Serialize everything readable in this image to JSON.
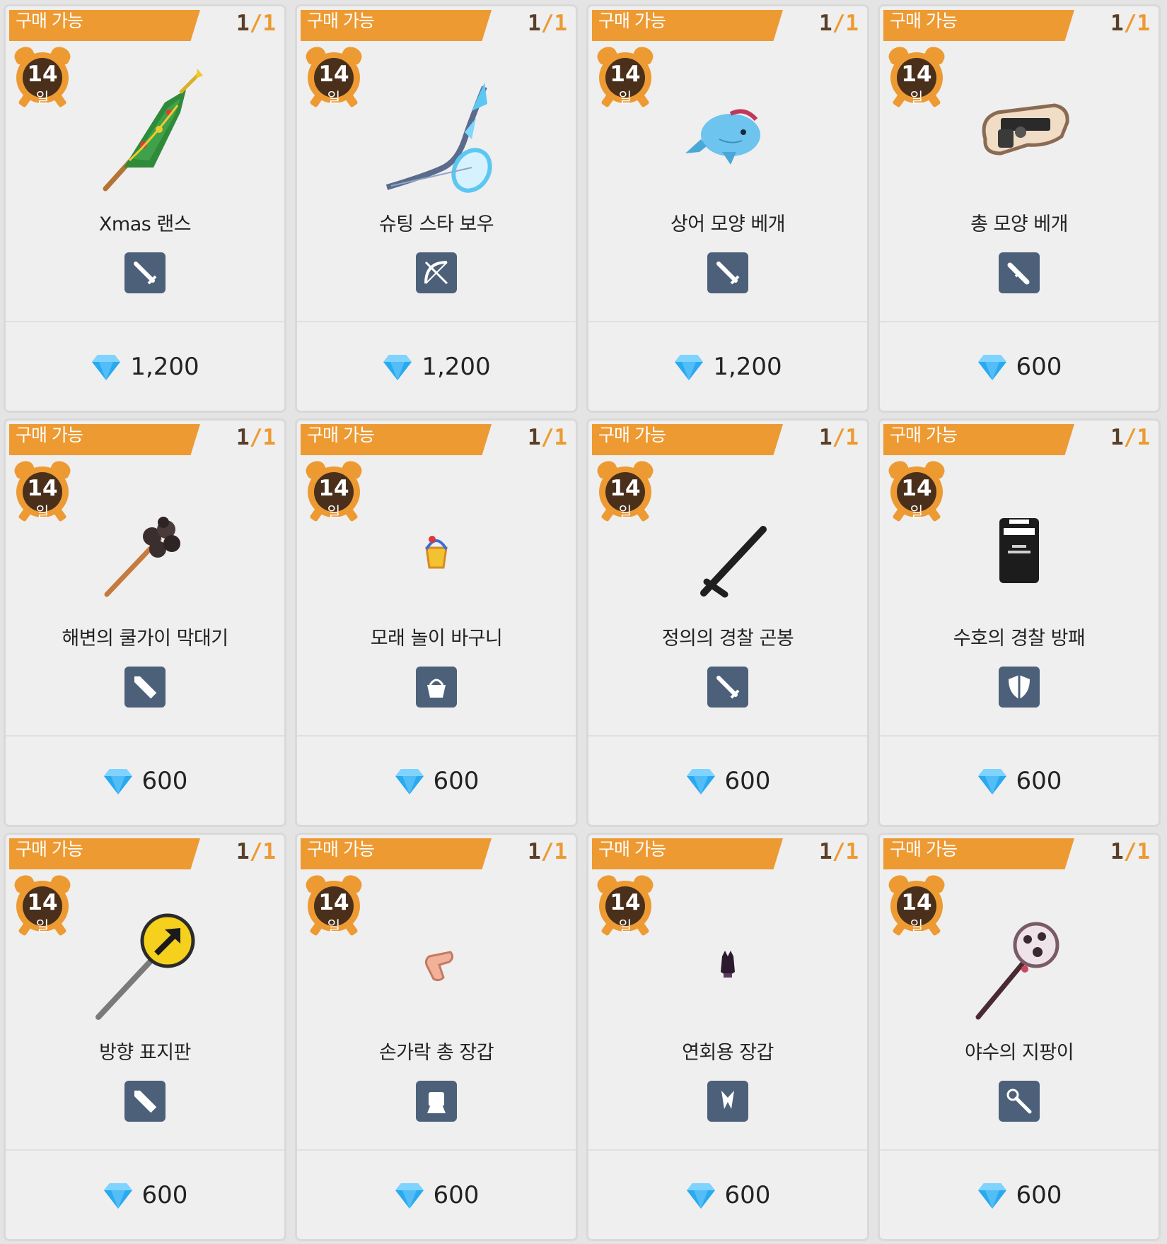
{
  "shop": {
    "items": [
      {
        "status": "구매 가능",
        "stock_current": "1",
        "stock_sep": "/",
        "stock_max": "1",
        "timer_value": "14",
        "timer_unit": "일",
        "name": "Xmas 랜스",
        "price": "1,200",
        "art_icon": "xmas-lance-icon",
        "type_icon": "sword-type-icon"
      },
      {
        "status": "구매 가능",
        "stock_current": "1",
        "stock_sep": "/",
        "stock_max": "1",
        "timer_value": "14",
        "timer_unit": "일",
        "name": "슈팅 스타 보우",
        "price": "1,200",
        "art_icon": "shooting-star-bow-icon",
        "type_icon": "bow-type-icon"
      },
      {
        "status": "구매 가능",
        "stock_current": "1",
        "stock_sep": "/",
        "stock_max": "1",
        "timer_value": "14",
        "timer_unit": "일",
        "name": "상어 모양 베개",
        "price": "1,200",
        "art_icon": "shark-pillow-icon",
        "type_icon": "sword-type-icon"
      },
      {
        "status": "구매 가능",
        "stock_current": "1",
        "stock_sep": "/",
        "stock_max": "1",
        "timer_value": "14",
        "timer_unit": "일",
        "name": "총 모양 베개",
        "price": "600",
        "art_icon": "gun-pillow-icon",
        "type_icon": "gun-type-icon"
      },
      {
        "status": "구매 가능",
        "stock_current": "1",
        "stock_sep": "/",
        "stock_max": "1",
        "timer_value": "14",
        "timer_unit": "일",
        "name": "해변의 쿨가이 막대기",
        "price": "600",
        "art_icon": "beach-stick-icon",
        "type_icon": "blade-type-icon"
      },
      {
        "status": "구매 가능",
        "stock_current": "1",
        "stock_sep": "/",
        "stock_max": "1",
        "timer_value": "14",
        "timer_unit": "일",
        "name": "모래 놀이 바구니",
        "price": "600",
        "art_icon": "sand-basket-icon",
        "type_icon": "basket-type-icon"
      },
      {
        "status": "구매 가능",
        "stock_current": "1",
        "stock_sep": "/",
        "stock_max": "1",
        "timer_value": "14",
        "timer_unit": "일",
        "name": "정의의 경찰 곤봉",
        "price": "600",
        "art_icon": "police-baton-icon",
        "type_icon": "sword-type-icon"
      },
      {
        "status": "구매 가능",
        "stock_current": "1",
        "stock_sep": "/",
        "stock_max": "1",
        "timer_value": "14",
        "timer_unit": "일",
        "name": "수호의 경찰 방패",
        "price": "600",
        "art_icon": "police-shield-icon",
        "type_icon": "shield-type-icon"
      },
      {
        "status": "구매 가능",
        "stock_current": "1",
        "stock_sep": "/",
        "stock_max": "1",
        "timer_value": "14",
        "timer_unit": "일",
        "name": "방향 표지판",
        "price": "600",
        "art_icon": "direction-sign-icon",
        "type_icon": "blade-type-icon"
      },
      {
        "status": "구매 가능",
        "stock_current": "1",
        "stock_sep": "/",
        "stock_max": "1",
        "timer_value": "14",
        "timer_unit": "일",
        "name": "손가락 총 장갑",
        "price": "600",
        "art_icon": "finger-gun-glove-icon",
        "type_icon": "fist-type-icon"
      },
      {
        "status": "구매 가능",
        "stock_current": "1",
        "stock_sep": "/",
        "stock_max": "1",
        "timer_value": "14",
        "timer_unit": "일",
        "name": "연회용 장갑",
        "price": "600",
        "art_icon": "banquet-glove-icon",
        "type_icon": "claw-type-icon"
      },
      {
        "status": "구매 가능",
        "stock_current": "1",
        "stock_sep": "/",
        "stock_max": "1",
        "timer_value": "14",
        "timer_unit": "일",
        "name": "야수의 지팡이",
        "price": "600",
        "art_icon": "beast-staff-icon",
        "type_icon": "staff-type-icon"
      }
    ]
  },
  "colors": {
    "banner": "#ed9a32",
    "card_bg": "#efefef",
    "timer_inner": "#4a2f1b",
    "type_icon_bg": "#4d607a",
    "gem": "#29a9f0"
  }
}
